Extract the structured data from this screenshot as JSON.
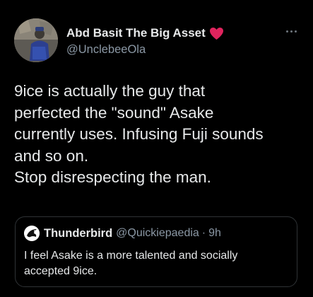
{
  "author": {
    "name": "Abd Basit The Big Asset",
    "handle": "@UnclebeeOla",
    "emoji": "heart-icon"
  },
  "tweet": {
    "lines": [
      "9ice is actually the guy that",
      "perfected the \"sound\" Asake",
      "currently uses. Infusing Fuji sounds",
      "and so on.",
      "Stop disrespecting the man."
    ]
  },
  "quoted": {
    "name": "Thunderbird",
    "handle": "@Quickiepaedia",
    "separator": "·",
    "time": "9h",
    "lines": [
      "I feel Asake is a more talented and socially",
      "accepted 9ice."
    ]
  },
  "icons": {
    "more": "more-options-icon",
    "heart": "heart-icon"
  },
  "colors": {
    "background": "#000000",
    "text": "#e7e9ea",
    "muted": "#8b98a5",
    "heart": "#e0245e",
    "border": "#2f3336"
  }
}
